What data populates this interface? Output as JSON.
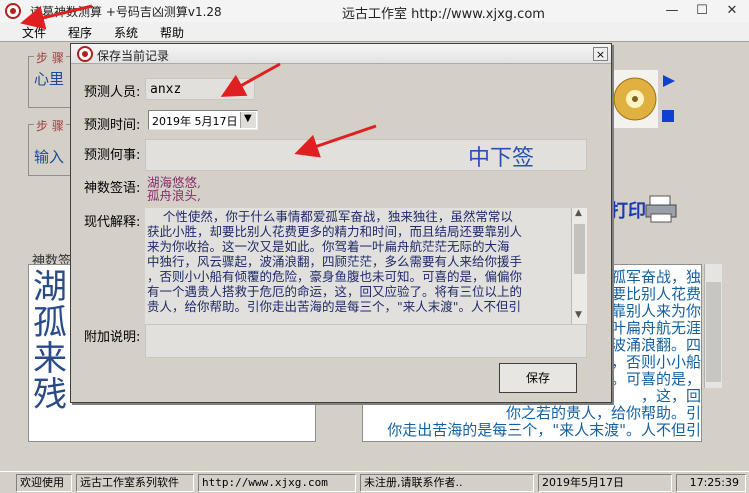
{
  "window": {
    "title": "诸葛神数测算 +号码吉凶测算v1.28",
    "studio": "远古工作室 http://www.xjxg.com"
  },
  "menu": [
    "文件",
    "程序",
    "系统",
    "帮助"
  ],
  "background": {
    "step1_label": "步 骤",
    "step1_text": "心里",
    "step2_label": "步 骤",
    "step2_text": "输入",
    "shenshu_label": "神数签",
    "big_chars": [
      "湖",
      "孤",
      "来",
      "残"
    ],
    "print_label": "打印",
    "right_text": "孤军奋战，独\n要比别人花费\n靠别人来为你\n一叶扁舟航无涯\n波涌浪翻。四\n，否则小小船\n。可喜的是，\n，这，回\n你之若的贵人，给你帮助。引\n你走出苦海的是每三个，\"来人末渡\"。人不但引"
  },
  "dialog": {
    "title": "保存当前记录",
    "close": "×",
    "labels": {
      "person": "预测人员:",
      "time": "预测时间:",
      "matter": "预测何事:",
      "poem": "神数签语:",
      "modern": "现代解释:",
      "note": "附加说明:"
    },
    "person_value": "anxz",
    "date_value": "2019年 5月17日",
    "matter_value": "",
    "result_label": "中下签",
    "poem_lines": [
      "湖海悠悠,",
      "孤舟浪头,"
    ],
    "modern_text": "    个性使然，你于什么事情都爱孤军奋战，独来独往，虽然常常以\n获此小胜，却要比别人花费更多的精力和时间，而且结局还要靠别人\n来为你收拾。这一次又是如此。你驾着一叶扁舟航茫茫无际的大海\n中独行，风云骤起，波涌浪翻，四顾茫茫，多么需要有人来给你援手\n，否则小小船有倾覆的危险，豪身鱼腹也未可知。可喜的是，偏偏你\n有一个遇贵人搭救于危厄的命运，这，回又应验了。将有三位以上的\n贵人，给你帮助。引你走出苦海的是每三个，\"来人末渡\"。人不但引",
    "save_label": "保存"
  },
  "statusbar": {
    "welcome": "欢迎使用",
    "software": "远古工作室系列软件",
    "url": "http://www.xjxg.com",
    "unregistered": "未注册,请联系作者..",
    "date": "2019年5月17日",
    "time": "17:25:39"
  },
  "colors": {
    "annotation_arrow": "#e02020",
    "result_text": "#2850b0",
    "poem_text": "#8a2a6a",
    "group_label": "#a04040"
  }
}
